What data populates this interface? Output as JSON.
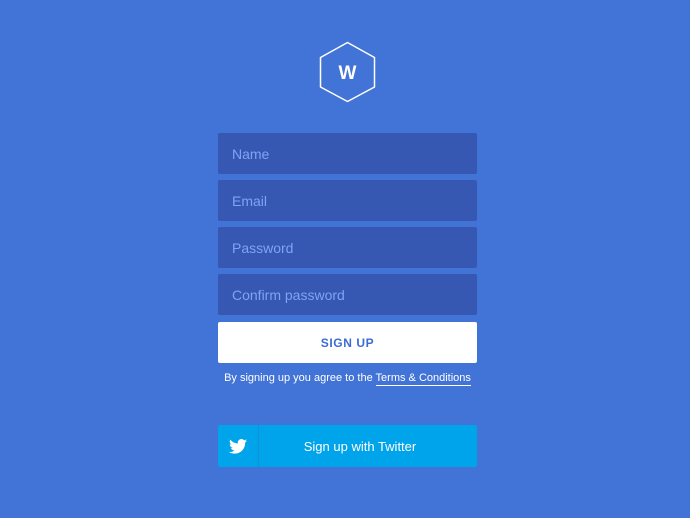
{
  "logo": {
    "letter": "W",
    "icon": "hexagon-logo-icon"
  },
  "form": {
    "name_placeholder": "Name",
    "email_placeholder": "Email",
    "password_placeholder": "Password",
    "confirm_placeholder": "Confirm password",
    "submit_label": "SIGN UP"
  },
  "terms": {
    "prefix": "By signing up you agree to the ",
    "link_label": "Terms & Conditions"
  },
  "twitter": {
    "label": "Sign up with Twitter",
    "icon": "twitter-bird-icon"
  },
  "colors": {
    "background": "#4273d6",
    "field_background": "#3658b2",
    "placeholder": "#7ea4f4",
    "button_text": "#3b6bd3",
    "twitter": "#00a4eb"
  }
}
